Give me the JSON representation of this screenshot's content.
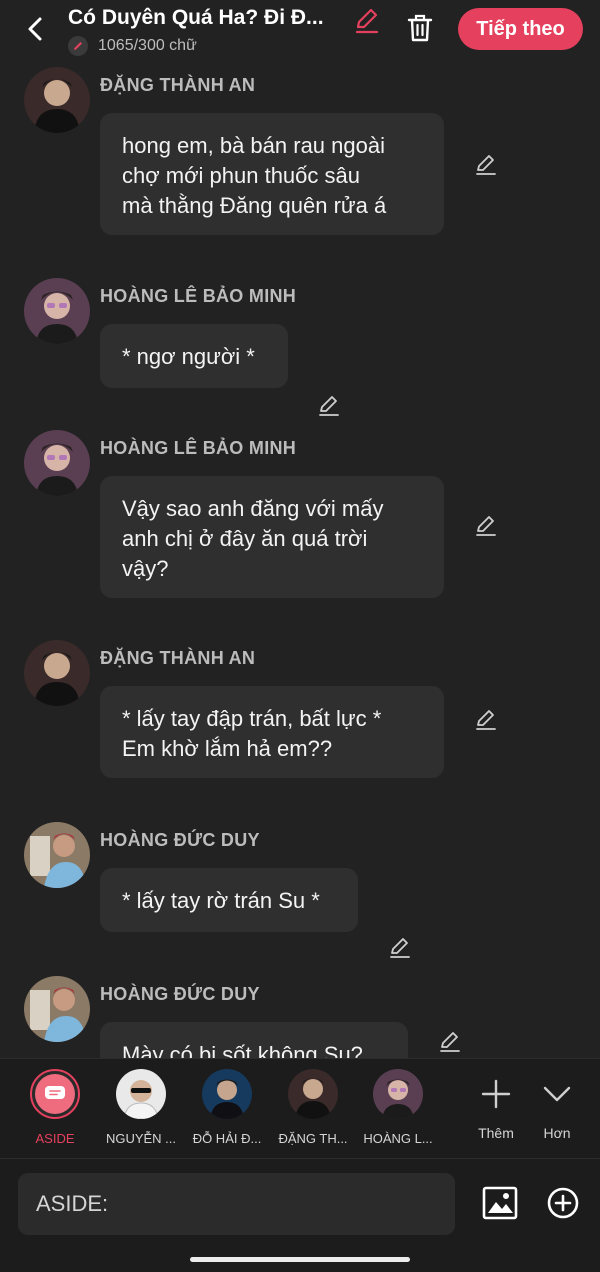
{
  "header": {
    "title": "Có Duyên Quá Ha? Đi Đ...",
    "word_count": "1065/300 chữ",
    "next_label": "Tiếp theo"
  },
  "messages": [
    {
      "name": "ĐẶNG THÀNH AN",
      "lines": [
        "hong em, bà bán rau ngoài",
        "chợ mới phun thuốc sâu",
        "mà thằng Đăng quên rửa á"
      ]
    },
    {
      "name": "HOÀNG LÊ BẢO MINH",
      "lines": [
        "* ngơ người *"
      ]
    },
    {
      "name": "HOÀNG LÊ BẢO MINH",
      "lines": [
        "Vậy sao anh đăng với mấy",
        "anh chị ở đây ăn quá trời",
        "vậy?"
      ]
    },
    {
      "name": "ĐẶNG THÀNH AN",
      "lines": [
        "* lấy tay đập trán, bất lực *",
        "Em khờ lắm hả em??"
      ]
    },
    {
      "name": "HOÀNG ĐỨC DUY",
      "lines": [
        "* lấy tay rờ trán Su *"
      ]
    },
    {
      "name": "HOÀNG ĐỨC DUY",
      "lines": [
        "Mày có bị sốt không Su?"
      ]
    }
  ],
  "characters": [
    {
      "label": "ASIDE"
    },
    {
      "label": "NGUYỄN ..."
    },
    {
      "label": "ĐỖ HẢI Đ..."
    },
    {
      "label": "ĐẶNG TH..."
    },
    {
      "label": "HOÀNG L..."
    }
  ],
  "tools": {
    "more_label": "Thêm",
    "less_label": "Hơn"
  },
  "input": {
    "placeholder": "ASIDE:"
  },
  "colors": {
    "accent": "#e5405d",
    "background": "#222222",
    "bubble": "#2f2f2f"
  }
}
